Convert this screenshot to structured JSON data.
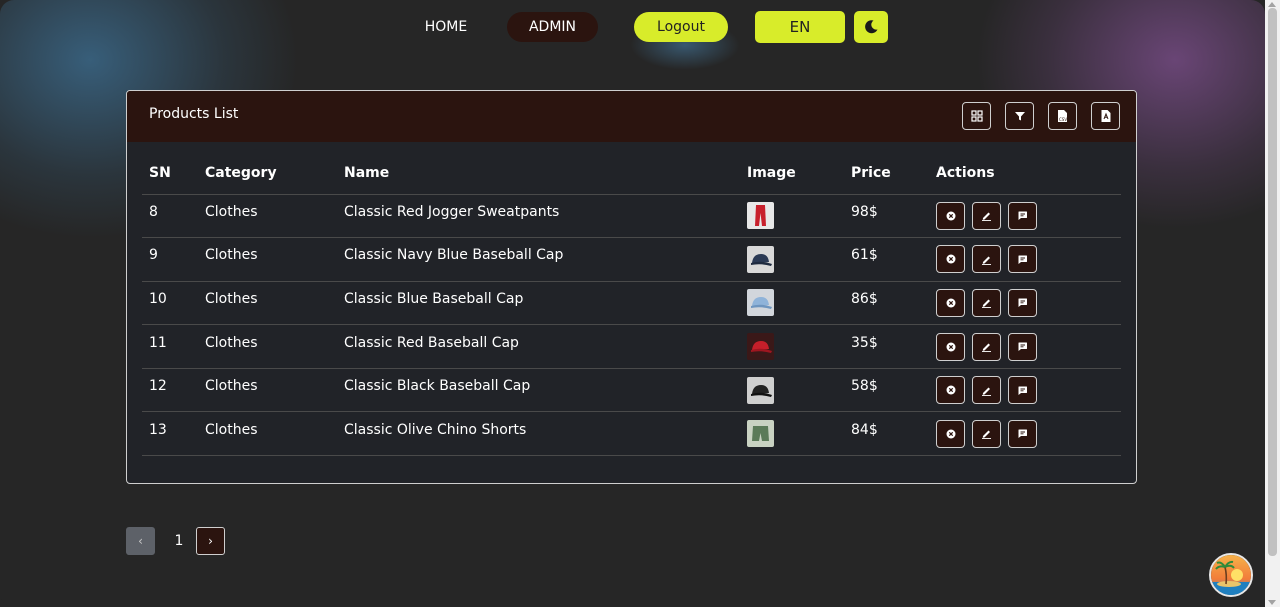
{
  "nav": {
    "home": "HOME",
    "admin": "ADMIN",
    "logout": "Logout",
    "language": "EN",
    "theme_icon": "moon-icon"
  },
  "products": {
    "title": "Products List",
    "toolbar_icons": [
      "columns-icon",
      "filter-icon",
      "csv-export-icon",
      "pdf-export-icon"
    ],
    "columns": [
      "SN",
      "Category",
      "Name",
      "Image",
      "Price",
      "Actions"
    ],
    "rows": [
      {
        "sn": "8",
        "category": "Clothes",
        "name": "Classic Red Jogger Sweatpants",
        "image": "red-sweatpants-thumbnail",
        "price": "98$"
      },
      {
        "sn": "9",
        "category": "Clothes",
        "name": "Classic Navy Blue Baseball Cap",
        "image": "navy-cap-thumbnail",
        "price": "61$"
      },
      {
        "sn": "10",
        "category": "Clothes",
        "name": "Classic Blue Baseball Cap",
        "image": "blue-cap-thumbnail",
        "price": "86$"
      },
      {
        "sn": "11",
        "category": "Clothes",
        "name": "Classic Red Baseball Cap",
        "image": "red-cap-thumbnail",
        "price": "35$"
      },
      {
        "sn": "12",
        "category": "Clothes",
        "name": "Classic Black Baseball Cap",
        "image": "black-cap-thumbnail",
        "price": "58$"
      },
      {
        "sn": "13",
        "category": "Clothes",
        "name": "Classic Olive Chino Shorts",
        "image": "olive-shorts-thumbnail",
        "price": "84$"
      }
    ],
    "action_icons": [
      "delete-icon",
      "edit-icon",
      "comment-icon"
    ]
  },
  "pagination": {
    "prev": "‹",
    "current_page": "1",
    "next": "›"
  },
  "colors": {
    "accent": "#d8ec2a",
    "dark_brown": "#2b140f",
    "background": "#262626",
    "card": "#212328"
  }
}
